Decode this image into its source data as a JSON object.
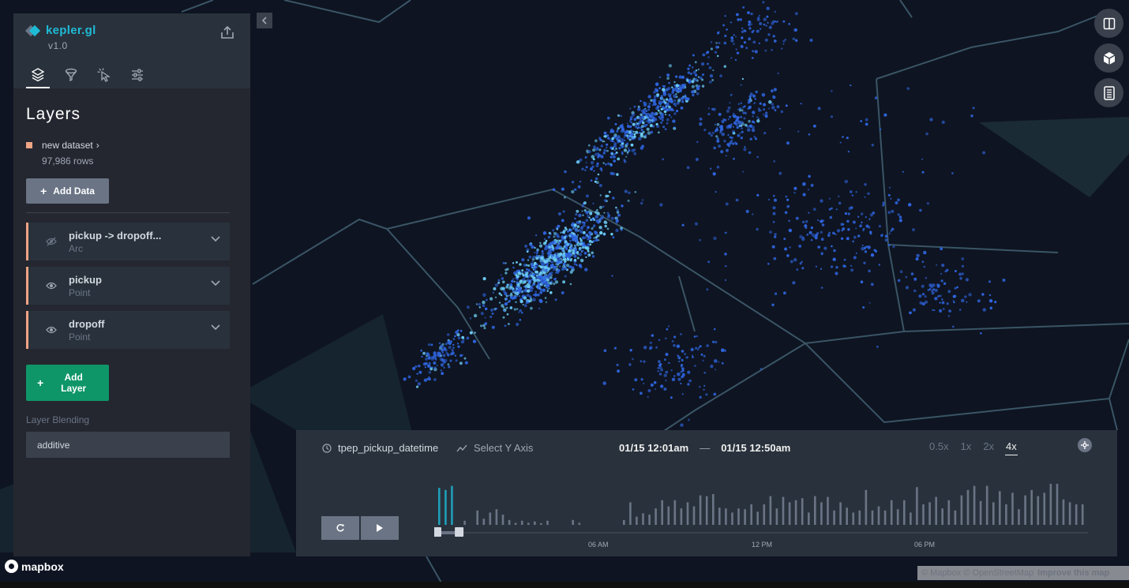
{
  "app": {
    "name": "kepler.gl",
    "version": "v1.0"
  },
  "colors": {
    "brand": "#1fbad6",
    "dataset": "#f0a484",
    "add_layer": "#0f9668",
    "points_primary": "#2f65e0",
    "points_bright": "#6ccdf5",
    "histogram_selected": "#1f9eb8",
    "histogram": "#6a7485"
  },
  "panel": {
    "tabs": [
      {
        "name": "layers",
        "icon": "layers-icon",
        "active": true
      },
      {
        "name": "filters",
        "icon": "filter-icon",
        "active": false
      },
      {
        "name": "interactions",
        "icon": "cursor-click-icon",
        "active": false
      },
      {
        "name": "map-style",
        "icon": "sliders-icon",
        "active": false
      }
    ],
    "title": "Layers",
    "dataset": {
      "name": "new dataset",
      "rows": "97,986 rows"
    },
    "add_data_label": "Add Data",
    "layers": [
      {
        "name": "pickup -> dropoff...",
        "type": "Arc",
        "visible": false
      },
      {
        "name": "pickup",
        "type": "Point",
        "visible": true
      },
      {
        "name": "dropoff",
        "type": "Point",
        "visible": true
      }
    ],
    "add_layer_label": "Add Layer",
    "blending_label": "Layer Blending",
    "blending_value": "additive"
  },
  "map_controls": [
    {
      "name": "split-map",
      "icon": "split-map-icon"
    },
    {
      "name": "3d-view",
      "icon": "cube-icon"
    },
    {
      "name": "legend",
      "icon": "legend-icon"
    }
  ],
  "time_widget": {
    "field": "tpep_pickup_datetime",
    "y_axis_placeholder": "Select Y Axis",
    "range_start": "01/15 12:01am",
    "range_end": "01/15 12:50am",
    "speeds": [
      "0.5x",
      "1x",
      "2x",
      "4x"
    ],
    "active_speed": "4x",
    "tick_labels": [
      "06 AM",
      "12 PM",
      "06 PM"
    ],
    "selection_fraction": [
      0.0,
      0.034
    ],
    "histogram": [
      0.9,
      0.85,
      0.95,
      0,
      0.1,
      0,
      0.35,
      0.15,
      0.3,
      0.38,
      0.25,
      0.12,
      0.05,
      0.1,
      0.05,
      0.08,
      0.04,
      0.1,
      0,
      0,
      0,
      0.12,
      0.05,
      0,
      0,
      0,
      0,
      0,
      0,
      0.12,
      0.55,
      0.2,
      0.28,
      0.25,
      0.4,
      0.6,
      0.45,
      0.6,
      0.4,
      0.55,
      0.45,
      0.72,
      0.7,
      0.75,
      0.42,
      0.4,
      0.3,
      0.4,
      0.38,
      0.5,
      0.32,
      0.5,
      0.7,
      0.4,
      0.68,
      0.55,
      0.6,
      0.65,
      0.3,
      0.7,
      0.55,
      0.68,
      0.35,
      0.55,
      0.42,
      0.3,
      0.35,
      0.85,
      0.35,
      0.45,
      0.35,
      0.6,
      0.38,
      0.6,
      0.3,
      0.92,
      0.5,
      0.55,
      0.68,
      0.4,
      0.6,
      0.35,
      0.72,
      0.85,
      0.95,
      0.58,
      0.95,
      0.55,
      0.82,
      0.5,
      0.78,
      0.38,
      0.72,
      0.85,
      0.7,
      0.78,
      1.0,
      1.0,
      0.62,
      0.55,
      0.5,
      0.5
    ]
  },
  "attribution": {
    "logo": "mapbox",
    "text": "© Mapbox © OpenStreetMap",
    "improve": "Improve this map"
  }
}
